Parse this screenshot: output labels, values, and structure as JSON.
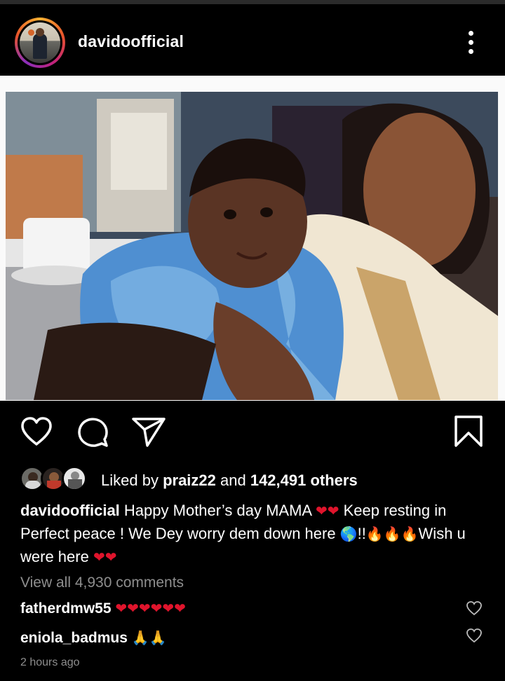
{
  "post": {
    "username": "davidoofficial",
    "liked_prefix": "Liked by ",
    "liked_user": "praiz22",
    "liked_and": " and ",
    "liked_count": "142,491 others",
    "caption_user": "davidoofficial",
    "caption_part1": "Happy Mother’s  day MAMA ",
    "caption_part2": " Keep resting in Perfect peace ! We Dey worry dem down here ",
    "caption_part3": "!!",
    "caption_part4": "Wish u were here ",
    "view_all_comments": "View all 4,930 comments",
    "timestamp": "2 hours ago"
  },
  "comments": [
    {
      "user": "fatherdmw55",
      "emoji": "❤❤❤❤❤❤"
    },
    {
      "user": "eniola_badmus",
      "emoji": "🙏🙏"
    }
  ],
  "icons": {
    "more": "more-vertical-icon",
    "like": "heart-outline-icon",
    "comment": "speech-bubble-icon",
    "share": "paper-plane-icon",
    "save": "bookmark-icon"
  },
  "colors": {
    "background": "#000000",
    "secondary_text": "#8e8e8e",
    "heart_red": "#e0142c"
  }
}
